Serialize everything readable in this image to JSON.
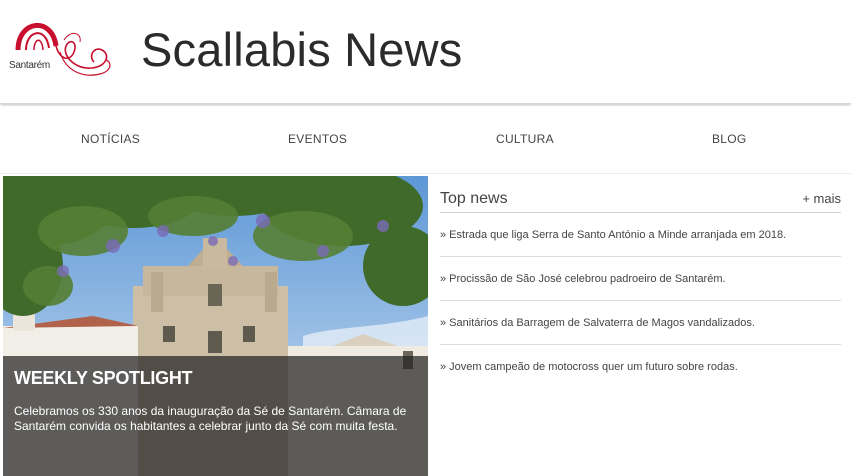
{
  "header": {
    "logo_text": "Santarém",
    "site_title": "Scallabis News"
  },
  "nav": {
    "items": [
      "NOTÍCIAS",
      "EVENTOS",
      "CULTURA",
      "BLOG"
    ]
  },
  "spotlight": {
    "heading": "WEEKLY SPOTLIGHT",
    "text": "Celebramos os 330 anos da inauguração da Sé de Santarém. Câmara de Santarém convida os habitantes a celebrar junto da Sé com muita festa."
  },
  "top_news": {
    "title": "Top news",
    "more_label": "+ mais",
    "items": [
      "» Estrada que liga Serra de Santo António a Minde arranjada em 2018.",
      "» Procissão de São José celebrou padroeiro de Santarém.",
      "» Sanitários da Barragem de Salvaterra de Magos vandalizados.",
      "» Jovem campeão de motocross quer um futuro sobre rodas."
    ]
  },
  "colors": {
    "logo_red": "#c8102e",
    "overlay": "#232323"
  }
}
